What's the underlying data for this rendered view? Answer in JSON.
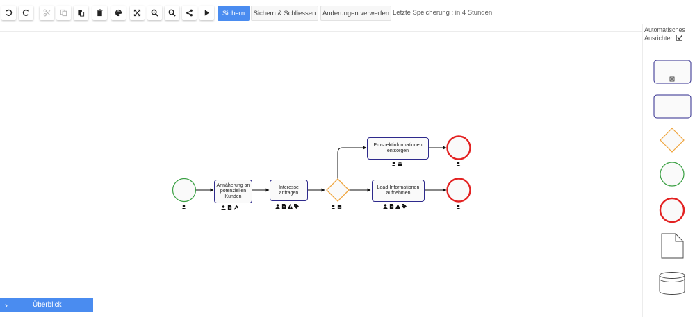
{
  "toolbar": {
    "save_label": "Sichern",
    "save_close_label": "Sichern & Schliessen",
    "discard_label": "Änderungen verwerfen",
    "last_save": "Letzte Speicherung : in 4 Stunden"
  },
  "sidebar": {
    "auto_align_line1": "Automatisches",
    "auto_align_line2": "Ausrichten",
    "auto_align_checked": true
  },
  "diagram": {
    "tasks": {
      "approach": "Annäherung an potenziellen Kunden",
      "request": "Interesse anfragen",
      "discard_prospect": "Prospektinformationen entsorgen",
      "record_lead": "Lead-Informationen aufnehmen"
    }
  },
  "overview": {
    "label": "Überblick"
  },
  "colors": {
    "primary": "#4a8cf0",
    "task_border": "#2e2a8c",
    "start_event": "#3aa043",
    "end_event": "#e32222",
    "gateway": "#f0a640"
  }
}
